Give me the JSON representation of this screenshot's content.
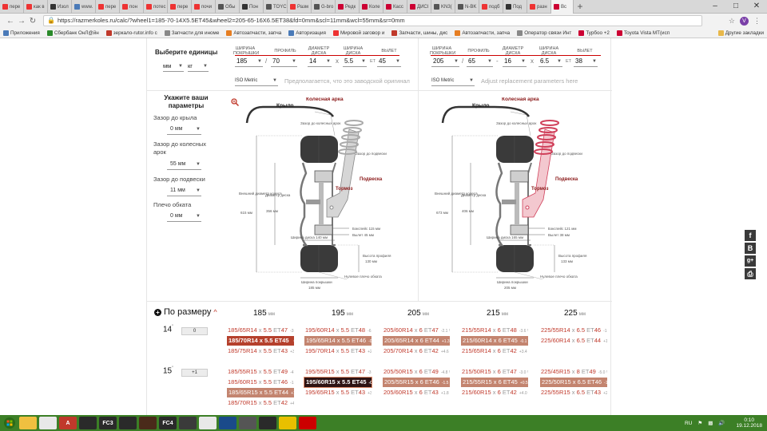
{
  "browser": {
    "tabs": [
      {
        "label": "пере",
        "color": "#e33"
      },
      {
        "label": "как в",
        "color": "#e33"
      },
      {
        "label": "Изол",
        "color": "#333"
      },
      {
        "label": "www.",
        "color": "#4a7ab8"
      },
      {
        "label": "пере",
        "color": "#e33"
      },
      {
        "label": "пон",
        "color": "#e33"
      },
      {
        "label": "потес",
        "color": "#e33"
      },
      {
        "label": "пере",
        "color": "#e33"
      },
      {
        "label": "почи",
        "color": "#e33"
      },
      {
        "label": "Обы",
        "color": "#555"
      },
      {
        "label": "Пон",
        "color": "#333"
      },
      {
        "label": "TOYC",
        "color": "#555"
      },
      {
        "label": "Разм",
        "color": "#e33"
      },
      {
        "label": "G-bro",
        "color": "#555"
      },
      {
        "label": "Редк",
        "color": "#c03"
      },
      {
        "label": "Коле",
        "color": "#c03"
      },
      {
        "label": "Касс",
        "color": "#c03"
      },
      {
        "label": "ДИСІ",
        "color": "#c03"
      },
      {
        "label": "KN3(",
        "color": "#555"
      },
      {
        "label": "N-BK",
        "color": "#555"
      },
      {
        "label": "подб",
        "color": "#e33"
      },
      {
        "label": "Под",
        "color": "#333"
      },
      {
        "label": "разн",
        "color": "#e33"
      },
      {
        "label": "Вс",
        "color": "#c03",
        "active": true
      }
    ],
    "new_tab": "+",
    "url": "https://razmerkoles.ru/calc/?wheel1=185-70-14X5.5ET45&wheel2=205-65-16X6.5ET38&fd=0mm&scl=11mm&wcl=55mm&sr=0mm",
    "bookmarks": [
      {
        "label": "Приложения",
        "color": "#4a7ab8"
      },
      {
        "label": "Сбербанк ОнЛ@йн",
        "color": "#2a8a2a"
      },
      {
        "label": "зеркало-rutor.info с",
        "color": "#c0392b"
      },
      {
        "label": "Запчасти для иноме",
        "color": "#888"
      },
      {
        "label": "Автозапчасти, запча",
        "color": "#e67e22"
      },
      {
        "label": "Авторизация",
        "color": "#4a7ab8"
      },
      {
        "label": "Мировой заговор и",
        "color": "#e33"
      },
      {
        "label": "Запчасти, шины, дис",
        "color": "#c0392b"
      },
      {
        "label": "Автозапчасти, запча",
        "color": "#e67e22"
      },
      {
        "label": "Оператор связи Инт",
        "color": "#888"
      },
      {
        "label": "Турбоо +2",
        "color": "#c03"
      },
      {
        "label": "Toyota Vista MT(исп",
        "color": "#c03"
      }
    ],
    "other_bookmarks": "Другие закладки"
  },
  "units": {
    "title": "Выберите единицы",
    "length": "мм",
    "weight": "кг"
  },
  "tire_labels": {
    "width": "ШИРИНА ПОКРЫШКИ",
    "profile": "ПРОФИЛЬ",
    "diameter": "ДИАМЕТР ДИСКА",
    "rim_width": "ШИРИНА ДИСКА",
    "offset": "ВЫЛЕТ"
  },
  "wheel1": {
    "width": "185",
    "profile": "70",
    "diameter": "14",
    "rim_width": "5.5",
    "offset": "45",
    "standard": "ISO Metric",
    "hint": "Предполагается, что это заводской оригинал"
  },
  "wheel2": {
    "width": "205",
    "profile": "65",
    "diameter": "16",
    "rim_width": "6.5",
    "offset": "38",
    "standard": "ISO Metric",
    "hint": "Adjust replacement parameters here"
  },
  "sep": {
    "slash": "/",
    "x": "x",
    "et": "ET"
  },
  "params": {
    "title": "Укажите ваши параметры",
    "fender_label": "Зазор до крыла",
    "fender": "0 мм",
    "arch_label": "Зазор до колесных арок",
    "arch": "55 мм",
    "susp_label": "Зазор до подвески",
    "susp": "11 мм",
    "scrub_label": "Плечо обката",
    "scrub": "0 мм"
  },
  "diagram_labels": {
    "fender": "Крыло",
    "arch": "Колесная арка",
    "arch_gap": "Зазор до колесных арок",
    "susp_gap": "Зазор до подвески",
    "suspension": "Подвеска",
    "brake": "Тормоз",
    "outer_diam": "Внешний диаметр колеса",
    "rim_diam": "Диаметр диска",
    "rim_width": "Ширина диска",
    "backspace": "Бэкспейс",
    "offset": "Вылет",
    "profile_height": "Высота профиля",
    "tire_width": "Ширина покрышки",
    "zero_scrub": "Нулевое плечо обката",
    "unit": "мм"
  },
  "diagram1": {
    "outer_diam": "615",
    "rim_diam": "356",
    "rim_width": "140",
    "backspace": "115",
    "offset": "45",
    "profile_height": "130",
    "tire_width": "185"
  },
  "diagram2": {
    "outer_diam": "673",
    "rim_diam": "406",
    "rim_width": "165",
    "backspace": "121",
    "offset": "38",
    "profile_height": "133",
    "tire_width": "205"
  },
  "sizes": {
    "title": "По размеру",
    "unit": "мм",
    "rim_unit": "\"",
    "columns": [
      "185",
      "195",
      "205",
      "215",
      "225"
    ],
    "rows": [
      {
        "rim": "14",
        "offset_btn": "0",
        "cells": [
          [
            {
              "size": "185/65R14",
              "rim": "5.5",
              "et": "47",
              "pct": "-3.0 %"
            },
            {
              "size": "185/70R14",
              "rim": "5.5",
              "et": "45",
              "pct": "OE",
              "style": "hl"
            },
            {
              "size": "185/75R14",
              "rim": "5.5",
              "et": "43",
              "pct": "+3.1 %"
            }
          ],
          [
            {
              "size": "195/60R14",
              "rim": "5.5",
              "et": "48",
              "pct": "-6.0 %"
            },
            {
              "size": "195/65R14",
              "rim": "5.5",
              "et": "46",
              "pct": "-0.8 %",
              "style": "hl2"
            },
            {
              "size": "195/70R14",
              "rim": "5.5",
              "et": "43",
              "pct": "+2.3 %"
            }
          ],
          [
            {
              "size": "205/60R14",
              "rim": "6",
              "et": "47",
              "pct": "-2.1 %"
            },
            {
              "size": "205/65R14",
              "rim": "6",
              "et": "44",
              "pct": "+1.3 %",
              "style": "hl2"
            },
            {
              "size": "205/70R14",
              "rim": "6",
              "et": "42",
              "pct": "+4.6 %"
            }
          ],
          [
            {
              "size": "215/55R14",
              "rim": "6",
              "et": "48",
              "pct": "-3.6 %"
            },
            {
              "size": "215/60R14",
              "rim": "6",
              "et": "45",
              "pct": "-0.1 %",
              "style": "hl2"
            },
            {
              "size": "215/65R14",
              "rim": "6",
              "et": "42",
              "pct": "+3.4 %"
            }
          ],
          [
            {
              "size": "225/55R14",
              "rim": "6.5",
              "et": "46",
              "pct": "-1.8 %"
            },
            {
              "size": "225/60R14",
              "rim": "6.5",
              "et": "44",
              "pct": "+1.8 %"
            }
          ]
        ]
      },
      {
        "rim": "15",
        "offset_btn": "+1",
        "cells": [
          [
            {
              "size": "185/55R15",
              "rim": "5.5",
              "et": "49",
              "pct": "-4.3 %"
            },
            {
              "size": "185/60R15",
              "rim": "5.5",
              "et": "46",
              "pct": "-1.3 %"
            },
            {
              "size": "185/65R15",
              "rim": "5.5",
              "et": "44",
              "pct": "+1.2 %",
              "style": "hl2"
            },
            {
              "size": "185/70R15",
              "rim": "5.5",
              "et": "42",
              "pct": "+4.2 %"
            }
          ],
          [
            {
              "size": "195/55R15",
              "rim": "5.5",
              "et": "47",
              "pct": "-3.1 %"
            },
            {
              "size": "195/60R15",
              "rim": "5.5",
              "et": "45",
              "pct": "-0.1 %",
              "style": "dark"
            },
            {
              "size": "195/65R15",
              "rim": "5.5",
              "et": "43",
              "pct": "+3.3 %"
            }
          ],
          [
            {
              "size": "205/50R15",
              "rim": "6",
              "et": "49",
              "pct": "-4.8 %"
            },
            {
              "size": "205/55R15",
              "rim": "6",
              "et": "46",
              "pct": "-1.5 %",
              "style": "hl2"
            },
            {
              "size": "205/60R15",
              "rim": "6",
              "et": "43",
              "pct": "+1.8 %"
            }
          ],
          [
            {
              "size": "215/50R15",
              "rim": "6",
              "et": "47",
              "pct": "-3.0 %"
            },
            {
              "size": "215/55R15",
              "rim": "6",
              "et": "45",
              "pct": "+0.5 %",
              "style": "hl2"
            },
            {
              "size": "215/60R15",
              "rim": "6",
              "et": "42",
              "pct": "+4.0 %"
            }
          ],
          [
            {
              "size": "225/45R15",
              "rim": "8",
              "et": "49",
              "pct": "-5.0 %"
            },
            {
              "size": "225/50R15",
              "rim": "6.5",
              "et": "46",
              "pct": "-1.3 %",
              "style": "hl2"
            },
            {
              "size": "225/55R15",
              "rim": "6.5",
              "et": "43",
              "pct": "+2.3 %"
            }
          ]
        ]
      }
    ]
  },
  "social": [
    "f",
    "в",
    "g+",
    "print"
  ],
  "taskbar": {
    "apps": [
      {
        "label": "",
        "color": "#f0c040"
      },
      {
        "label": "",
        "color": "#e8e8e8"
      },
      {
        "label": "A",
        "color": "#c0392b"
      },
      {
        "label": "",
        "color": "#2a2a2a"
      },
      {
        "label": "FC3",
        "color": "#2a2a2a"
      },
      {
        "label": "",
        "color": "#2a2a2a"
      },
      {
        "label": "",
        "color": "#4a2a1a"
      },
      {
        "label": "FC4",
        "color": "#2a2a2a"
      },
      {
        "label": "",
        "color": "#3a3a3a"
      },
      {
        "label": "",
        "color": "#e8e8e8"
      },
      {
        "label": "",
        "color": "#1a4a8a"
      },
      {
        "label": "",
        "color": "#555"
      },
      {
        "label": "",
        "color": "#2a2a2a"
      },
      {
        "label": "",
        "color": "#e8c000"
      },
      {
        "label": "",
        "color": "#c00"
      }
    ],
    "lang": "RU",
    "time": "0:10",
    "date": "19.12.2018"
  }
}
